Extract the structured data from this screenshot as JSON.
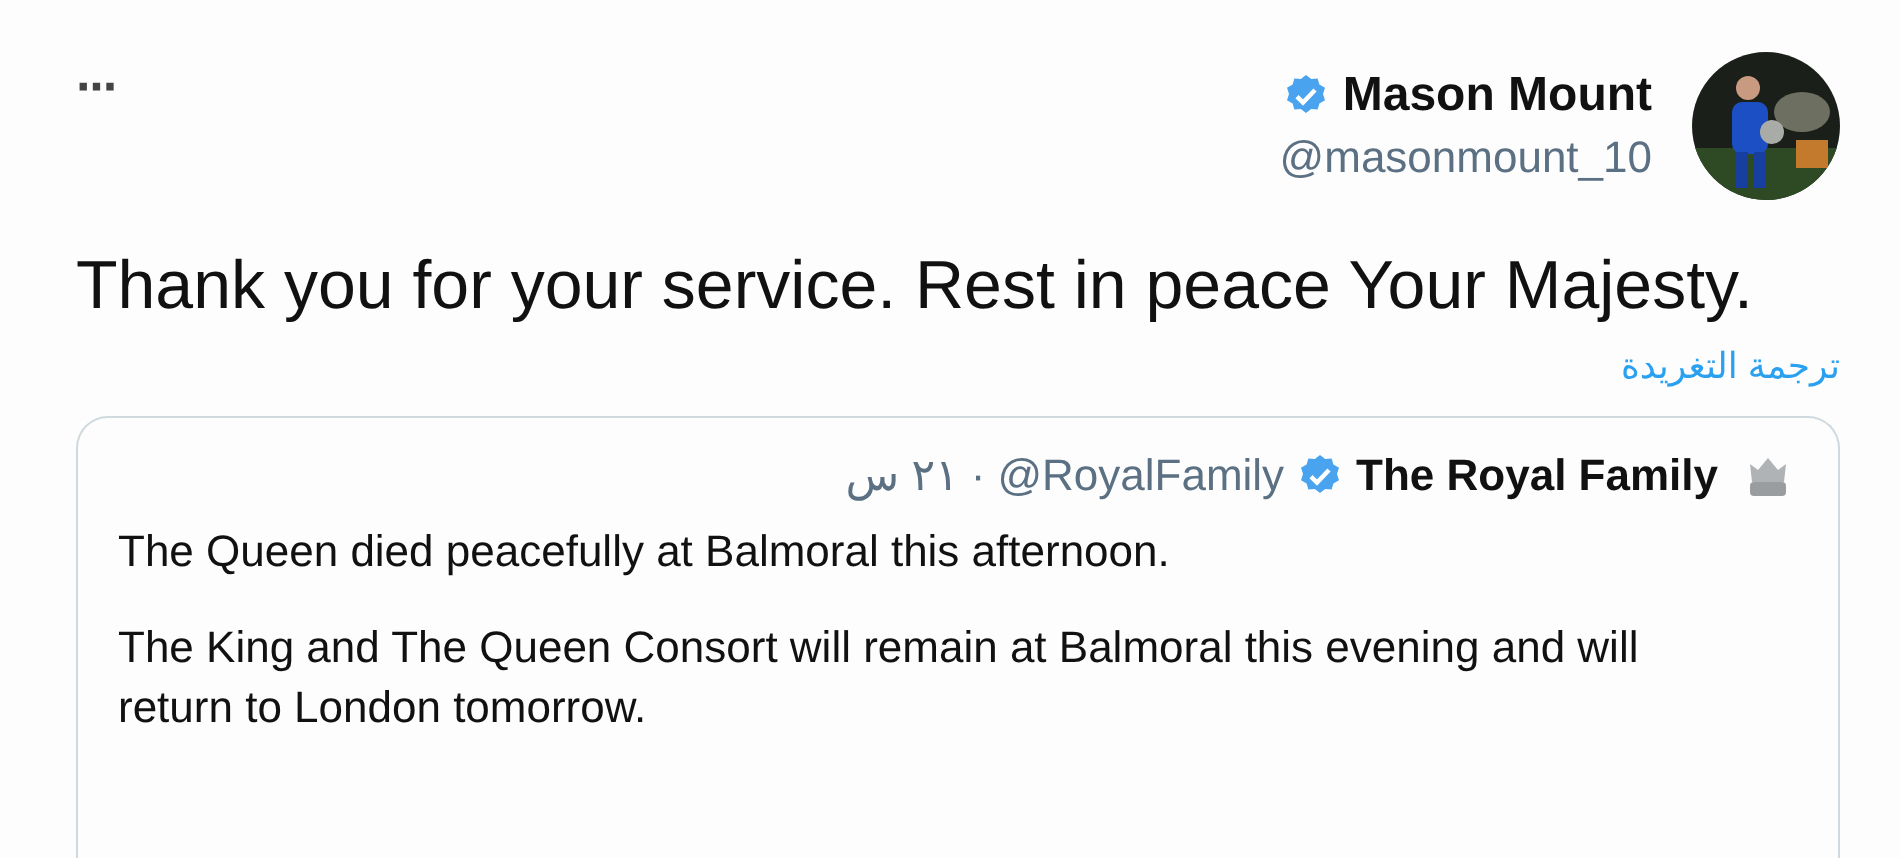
{
  "tweet": {
    "more": "···",
    "author": {
      "name": "Mason Mount",
      "handle": "@masonmount_10",
      "verified": true
    },
    "text": "Thank you for your service. Rest in peace Your Majesty.",
    "translate_link": "ترجمة التغريدة",
    "quoted": {
      "author": {
        "name": "The Royal Family",
        "handle": "@RoyalFamily",
        "verified": true
      },
      "separator": "·",
      "time": "٢١ س",
      "paragraphs": [
        "The Queen died peacefully at Balmoral this afternoon.",
        "The King and The Queen Consort will remain at Balmoral this evening and will return to London tomorrow."
      ]
    }
  }
}
